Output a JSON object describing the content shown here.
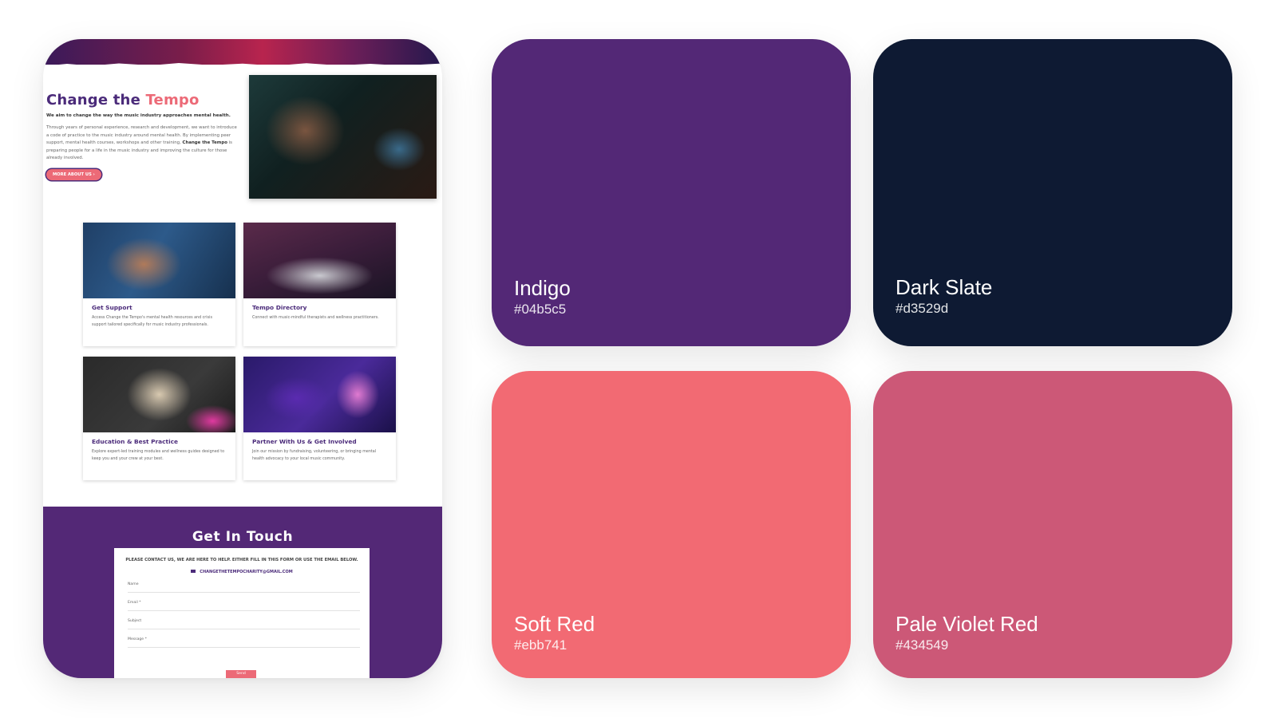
{
  "preview": {
    "intro": {
      "title": "Change the",
      "title_accent": "Tempo",
      "lead": "We aim to change the way the music industry approaches mental health.",
      "body_1": "Through years of personal experience, research and development, we want to introduce a code of practice to the music industry around mental health. By implementing peer support, mental health courses, workshops and other training,",
      "body_bold": "Change the Tempo",
      "body_2": "is preparing people for a life in the music industry and improving the culture for those already involved.",
      "button": "MORE ABOUT US ›"
    },
    "cards": [
      {
        "title": "Get Support",
        "description": "Access Change the Tempo's mental health resources and crisis support tailored specifically for music industry professionals."
      },
      {
        "title": "Tempo Directory",
        "description": "Connect with music-mindful therapists and wellness practitioners."
      },
      {
        "title": "Education & Best Practice",
        "description": "Explore expert-led training modules and wellness guides designed to keep you and your crew at your best."
      },
      {
        "title": "Partner With Us & Get Involved",
        "description": "Join our mission by fundraising, volunteering, or bringing mental health advocacy to your local music community."
      }
    ],
    "contact": {
      "title": "Get In Touch",
      "intro": "Please contact us, we are here to help. Either fill in this form or use the email below.",
      "email": "CHANGETHETEMPOCHARITY@GMAIL.COM",
      "fields": [
        "Name",
        "Email *",
        "Subject",
        "Message *"
      ],
      "send": "Send"
    }
  },
  "swatches": [
    {
      "name": "Indigo",
      "hex": "#04b5c5",
      "color": "#532876"
    },
    {
      "name": "Dark Slate",
      "hex": "#d3529d",
      "color": "#0e1a33"
    },
    {
      "name": "Soft Red",
      "hex": "#ebb741",
      "color": "#f26a73"
    },
    {
      "name": "Pale Violet Red",
      "hex": "#434549",
      "color": "#cc5877"
    }
  ]
}
